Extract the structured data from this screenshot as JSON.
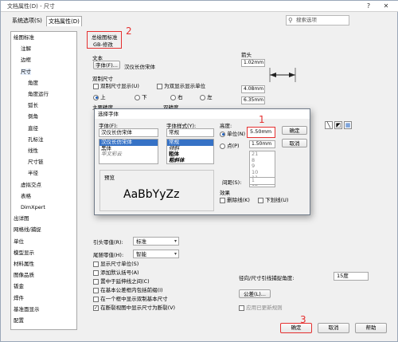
{
  "window": {
    "title": "文档属性(D) - 尺寸",
    "help_btn": "?",
    "close_btn": "✕"
  },
  "tabs": [
    {
      "label": "系统选项(S)"
    },
    {
      "label": "文档属性(D)"
    }
  ],
  "search": {
    "placeholder": "搜索选项"
  },
  "tree": [
    {
      "label": "绘图标准",
      "indent": 0
    },
    {
      "label": "注解",
      "indent": 1
    },
    {
      "label": "边框",
      "indent": 1
    },
    {
      "label": "尺寸",
      "indent": 1
    },
    {
      "label": "角度",
      "indent": 2
    },
    {
      "label": "角度运行",
      "indent": 2
    },
    {
      "label": "弧长",
      "indent": 2
    },
    {
      "label": "倒角",
      "indent": 2
    },
    {
      "label": "直径",
      "indent": 2
    },
    {
      "label": "孔标注",
      "indent": 2
    },
    {
      "label": "线性",
      "indent": 2
    },
    {
      "label": "尺寸链",
      "indent": 2
    },
    {
      "label": "半径",
      "indent": 2
    },
    {
      "label": "虚拟交点",
      "indent": 1
    },
    {
      "label": "表格",
      "indent": 1
    },
    {
      "label": "DimXpert",
      "indent": 1
    },
    {
      "label": "出详图",
      "indent": 0
    },
    {
      "label": "网格线/捕捉",
      "indent": 0
    },
    {
      "label": "单位",
      "indent": 0
    },
    {
      "label": "模型显示",
      "indent": 0
    },
    {
      "label": "材料属性",
      "indent": 0
    },
    {
      "label": "图像品质",
      "indent": 0
    },
    {
      "label": "钣金",
      "indent": 0
    },
    {
      "label": "焊件",
      "indent": 0
    },
    {
      "label": "基准面显示",
      "indent": 0
    },
    {
      "label": "配置",
      "indent": 0
    }
  ],
  "main": {
    "overall_standard_label": "总绘图标准",
    "overall_standard_value": "GB-修改",
    "text_label": "文本",
    "font_button": "字体(F)...",
    "font_value": "汉仪长仿宋体",
    "dual_label": "双制尺寸",
    "dual_show": "双制尺寸显示(U)",
    "dual_basic": "为双显示显示单位",
    "pos_up": "上",
    "pos_down": "下",
    "pos_right": "右",
    "pos_left": "左",
    "primary_precision": "主要精度",
    "dual_precision": "双精度",
    "arrows_label": "箭头",
    "arrow_v1": "1.02mm",
    "arrow_v2": "4.08mm",
    "arrow_v3": "6.35mm",
    "leader_zero_label": "引头零值(R):",
    "leader_zero_value": "标准",
    "trailing_zero_label": "尾随零值(H):",
    "trailing_zero_value": "智能",
    "cb_show_units": "显示尺寸单位(S)",
    "cb_add_brackets": "添加默认括号(A)",
    "cb_center_extension": "置中于延伸线之间(C)",
    "cb_basic_tolerance": "在基本公差框内包括前缀(I)",
    "cb_in_one_frame": "在一个框中显示双制基本尺寸",
    "cb_break_view": "在断裂视图中显示尺寸为断裂(V)",
    "radial_label": "径向/尺寸引线捕捉角度:",
    "radial_value": "15度",
    "offset_btn": "公差(L)...",
    "apply_updated": "应用已更新规则",
    "ok": "确定",
    "cancel": "取消",
    "help": "帮助"
  },
  "dialog": {
    "title": "选择字体",
    "font_label": "字体(F):",
    "font_value": "汉仪长仿宋体",
    "font_list": [
      "汉仪长仿宋体",
      "黑体",
      "华文彩云"
    ],
    "style_label": "字体样式(Y):",
    "style_value": "常规",
    "style_list": [
      "常规",
      "倾斜",
      "粗体",
      "粗斜体"
    ],
    "height_label": "高度:",
    "unit_label": "单位(N)",
    "unit_value": "5.50mm",
    "point_label": "点(P)",
    "point_value": "1.50mm",
    "size_list": [
      "21",
      "8",
      "9",
      "10",
      "11",
      "12"
    ],
    "spacing_label": "间距(S):",
    "spacing_value": "1",
    "preview_label": "预览",
    "preview_text": "AaBbYyZz",
    "effects_label": "效果",
    "strike_label": "删除线(K)",
    "underline_label": "下划线(U)",
    "ok": "确定",
    "cancel": "取消"
  },
  "annotations": {
    "n1": "1",
    "n2": "2",
    "n3": "3"
  },
  "colors": {
    "accent": "#3672c6",
    "annotation": "#e53030"
  }
}
